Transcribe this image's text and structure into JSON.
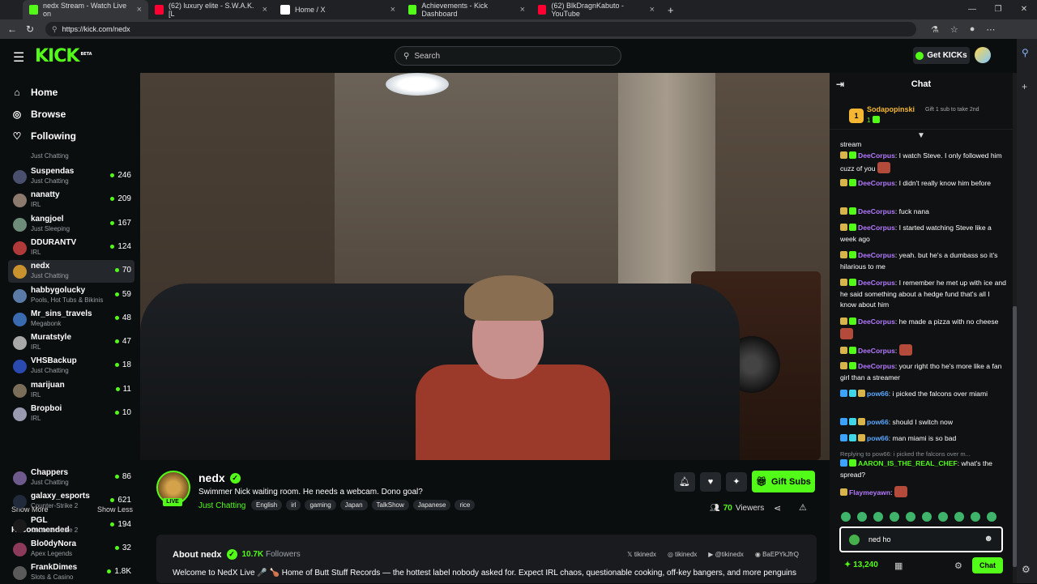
{
  "browser": {
    "tabs": [
      {
        "label": "nedx Stream - Watch Live on",
        "color": "#53fc18",
        "active": true
      },
      {
        "label": "(62) luxury elite - S.W.A.K. [L",
        "color": "#ff0033",
        "active": false
      },
      {
        "label": "Home / X",
        "color": "#ffffff",
        "active": false
      },
      {
        "label": "Achievements - Kick Dashboard",
        "color": "#53fc18",
        "active": false
      },
      {
        "label": "(62) BlkDragnKabuto - YouTube",
        "color": "#ff0033",
        "active": false
      }
    ],
    "url": "https://kick.com/nedx"
  },
  "header": {
    "logo": "KICK",
    "logo_sup": "BETA",
    "search_placeholder": "Search",
    "get_kicks": "Get KICKs"
  },
  "sidebar": {
    "nav": [
      {
        "label": "Home",
        "icon": "home-icon"
      },
      {
        "label": "Browse",
        "icon": "compass-icon"
      },
      {
        "label": "Following",
        "icon": "heart-icon"
      }
    ],
    "partial_category": "Just Chatting",
    "following": [
      {
        "name": "Suspendas",
        "category": "Just Chatting",
        "viewers": "246",
        "color": "#4a4f6e"
      },
      {
        "name": "nanatty",
        "category": "IRL",
        "viewers": "209",
        "color": "#8c7a6e"
      },
      {
        "name": "kangjoel",
        "category": "Just Sleeping",
        "viewers": "167",
        "color": "#6e8c7a"
      },
      {
        "name": "DDURANTV",
        "category": "IRL",
        "viewers": "124",
        "color": "#b03a3a"
      },
      {
        "name": "nedx",
        "category": "Just Chatting",
        "viewers": "70",
        "color": "#c8922f"
      },
      {
        "name": "habbygolucky",
        "category": "Pools, Hot Tubs & Bikinis",
        "viewers": "59",
        "color": "#5a7aa8"
      },
      {
        "name": "Mr_sins_travels",
        "category": "Megabonk",
        "viewers": "48",
        "color": "#3a6ab0"
      },
      {
        "name": "Muratstyle",
        "category": "IRL",
        "viewers": "47",
        "color": "#a8a8a8"
      },
      {
        "name": "VHSBackup",
        "category": "Just Chatting",
        "viewers": "18",
        "color": "#2a4ab0"
      },
      {
        "name": "marijuan",
        "category": "IRL",
        "viewers": "11",
        "color": "#7a6e5a"
      },
      {
        "name": "Bropboi",
        "category": "IRL",
        "viewers": "10",
        "color": "#9a9ab0"
      }
    ],
    "show_more": "Show More",
    "show_less": "Show Less",
    "recommended_title": "Recommended",
    "recommended": [
      {
        "name": "Chappers",
        "category": "Just Chatting",
        "viewers": "86",
        "color": "#6e5a8c"
      },
      {
        "name": "galaxy_esports",
        "category": "Counter-Strike 2",
        "viewers": "621",
        "color": "#202a3a"
      },
      {
        "name": "PGL",
        "category": "Counter-Strike 2",
        "viewers": "194",
        "color": "#1a1a1a"
      },
      {
        "name": "Blo0dyNora",
        "category": "Apex Legends",
        "viewers": "32",
        "color": "#8c3a5a"
      },
      {
        "name": "FrankDimes",
        "category": "Slots & Casino",
        "viewers": "1.8K",
        "color": "#5a5a5a"
      }
    ]
  },
  "stream": {
    "streamer": "nedx",
    "live": "LIVE",
    "title": "Swimmer Nick waiting room. He needs a webcam. Dono goal?",
    "category": "Just Chatting",
    "tags": [
      "English",
      "irl",
      "gaming",
      "Japan",
      "TalkShow",
      "Japanese",
      "rice"
    ],
    "gift_subs": "Gift Subs",
    "viewers_count": "70",
    "viewers_label": "Viewers"
  },
  "about": {
    "title": "About nedx",
    "followers_count": "10.7K",
    "followers_label": "Followers",
    "socials": [
      "tikinedx",
      "tikinedx",
      "@tikinedx",
      "BaEPYkJfrQ"
    ],
    "description": "Welcome to NedX Live 🎤 🍗 Home of Butt Stuff Records — the hottest label nobody asked for. Expect IRL chaos, questionable cooking, off-key bangers, and more penguins"
  },
  "chat": {
    "title": "Chat",
    "pinned": {
      "badge": "1",
      "user": "Sodapopinski",
      "count": "1",
      "gift_text": "Gift 1 sub to take 2nd"
    },
    "top_fragment": "stream",
    "messages": [
      {
        "user": "DeeCorpus",
        "text": "I watch Steve. I only followed him cuzz of you",
        "color": "#b479ff"
      },
      {
        "user": "DeeCorpus",
        "text": "I didn't really know him before",
        "color": "#b479ff"
      },
      {
        "user": "DeeCorpus",
        "text": "fuck nana",
        "color": "#b479ff"
      },
      {
        "user": "DeeCorpus",
        "text": "I started watching Steve like a week ago",
        "color": "#b479ff"
      },
      {
        "user": "DeeCorpus",
        "text": "yeah. but he's a dumbass so it's hilarious to me",
        "color": "#b479ff"
      },
      {
        "user": "DeeCorpus",
        "text": "I remember he met up with ice and he said something about a hedge fund that's all I know about him",
        "color": "#b479ff"
      },
      {
        "user": "DeeCorpus",
        "text": "he made a pizza with no cheese",
        "color": "#b479ff"
      },
      {
        "user": "DeeCorpus",
        "text": "",
        "color": "#b479ff"
      },
      {
        "user": "DeeCorpus",
        "text": "your right tho he's more like a fan girl than a streamer",
        "color": "#b479ff"
      },
      {
        "user": "pow66",
        "text": "i picked the falcons over miami",
        "color": "#5aa8ff"
      },
      {
        "user": "pow66",
        "text": "should I switch now",
        "color": "#5aa8ff"
      },
      {
        "user": "pow66",
        "text": "man miami is so bad",
        "color": "#5aa8ff"
      },
      {
        "user": "AARON_IS_THE_REAL_CHEF",
        "text": "what's the spread?",
        "color": "#53fc18"
      },
      {
        "user": "Flaymeyawn",
        "text": "",
        "color": "#b479ff"
      }
    ],
    "reply_note": "Replying to pow66: i picked the falcons over m...",
    "input_value": "ned ho",
    "kicks_balance": "13,240",
    "send_label": "Chat"
  }
}
